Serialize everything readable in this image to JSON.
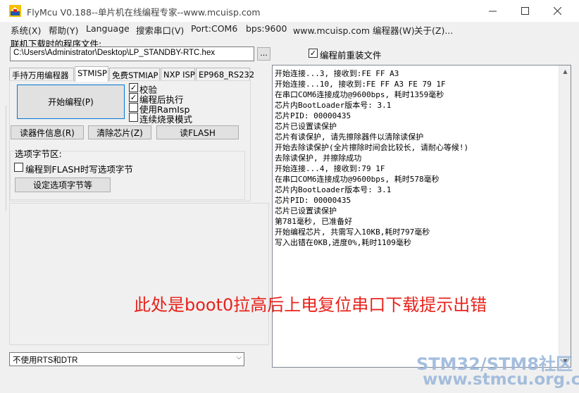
{
  "window": {
    "title": "FlyMcu V0.188--单片机在线编程专家--www.mcuisp.com"
  },
  "menu": {
    "items": [
      "系统(X)",
      "帮助(Y)",
      "Language",
      "搜索串口(V)",
      "Port:COM6",
      "bps:9600",
      "www.mcuisp.com 编程器(W)",
      "关于(Z)..."
    ]
  },
  "file": {
    "label": "联机下载时的程序文件:",
    "path": "C:\\Users\\Administrator\\Desktop\\LP_STANDBY-RTC.hex",
    "browse_label": "...",
    "reload_label": "编程前重装文件",
    "reload_checked": "✓"
  },
  "tabs": [
    "手持万用编程器",
    "STMISP",
    "免费STMIAP",
    "NXP ISP",
    "EP968_RS232"
  ],
  "stmisp": {
    "start_button": "开始编程(P)",
    "options": [
      {
        "label": "校验",
        "checked": "✓"
      },
      {
        "label": "编程后执行",
        "checked": "✓"
      },
      {
        "label": "使用RamIsp",
        "checked": ""
      },
      {
        "label": "连续烧录模式",
        "checked": ""
      }
    ],
    "read_info_button": "读器件信息(R)",
    "erase_button": "清除芯片(Z)",
    "read_flash_button": "读FLASH",
    "option_group_label": "选项字节区:",
    "write_option_label": "编程到FLASH时写选项字节",
    "write_option_checked": "",
    "set_option_button": "设定选项字节等"
  },
  "rts_dtr": {
    "selected": "不使用RTS和DTR"
  },
  "log": {
    "lines": [
      "开始连接...3, 接收到:FE FF A3",
      "开始连接...10, 接收到:FE FF A3 FE 79 1F",
      "在串口COM6连接成功@9600bps, 耗时1359毫秒",
      "芯片内BootLoader版本号: 3.1",
      "芯片PID: 00000435",
      "芯片已设置读保护",
      "芯片有读保护, 请先擦除器件以清除读保护",
      "开始去除读保护(全片擦除时间会比较长, 请耐心等候!)",
      "去除读保护, 并擦除成功",
      "开始连接...4, 接收到:79 1F",
      "在串口COM6连接成功@9600bps, 耗时578毫秒",
      "芯片内BootLoader版本号: 3.1",
      "芯片PID: 00000435",
      "芯片已设置读保护",
      "第781毫秒, 已准备好",
      "开始编程芯片, 共需写入10KB,耗时797毫秒",
      "写入出错在0KB,进度0%,耗时1109毫秒"
    ]
  },
  "annotation": {
    "text": "此处是boot0拉高后上电复位串口下载提示出错"
  },
  "watermark": {
    "line1": "STM32/STM8社区",
    "line2": "www.stmcu.org.cn"
  },
  "colors": {
    "annotation": "#e8221b",
    "watermark": "#9cb8da",
    "focus_border": "#0078d7"
  }
}
